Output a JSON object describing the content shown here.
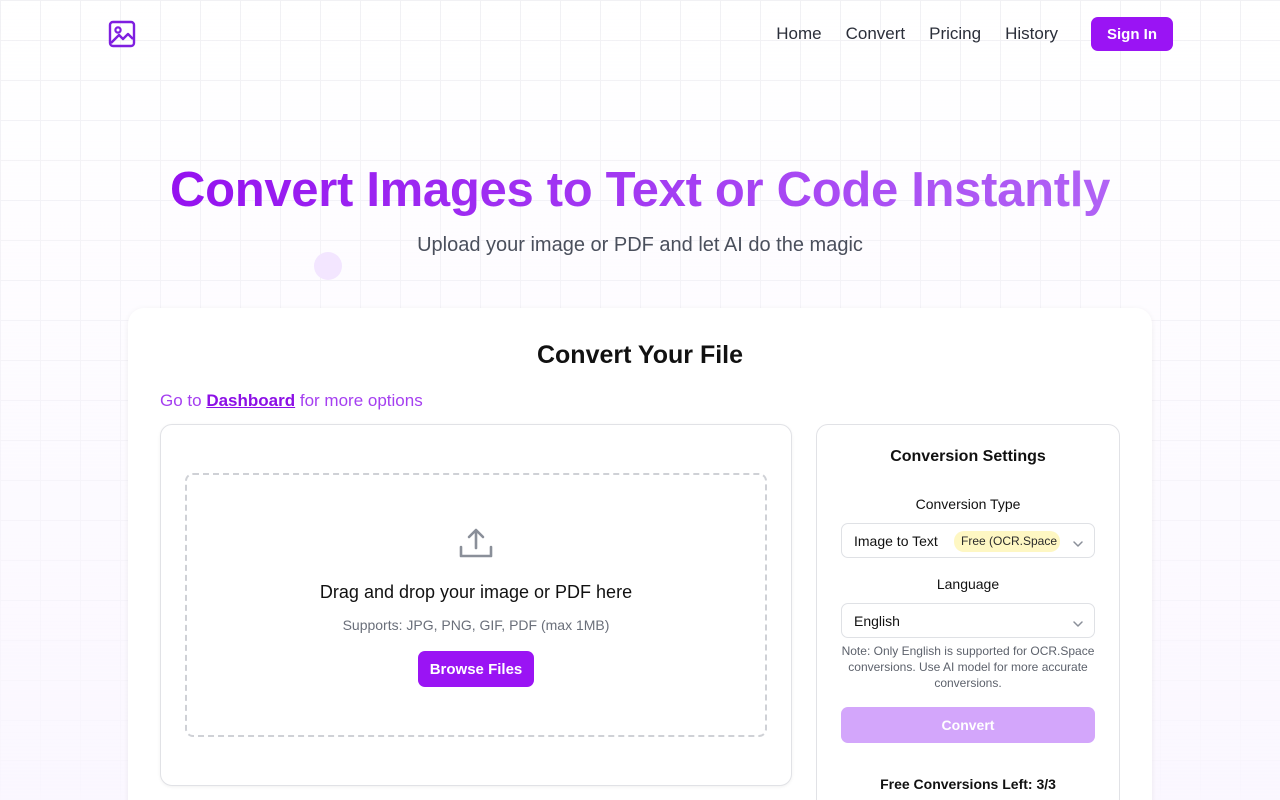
{
  "header": {
    "logo_icon": "image-icon",
    "nav": [
      {
        "label": "Home"
      },
      {
        "label": "Convert"
      },
      {
        "label": "Pricing"
      },
      {
        "label": "History"
      }
    ],
    "signin_label": "Sign In"
  },
  "hero": {
    "title": "Convert Images to Text or Code Instantly",
    "subtitle": "Upload your image or PDF and let AI do the magic"
  },
  "card": {
    "title": "Convert Your File",
    "dashboard_prefix": "Go to",
    "dashboard_link": "Dashboard",
    "dashboard_suffix": "for more options"
  },
  "upload": {
    "icon": "upload-icon",
    "title": "Drag and drop your image or PDF here",
    "supports": "Supports: JPG, PNG, GIF, PDF (max 1MB)",
    "browse_label": "Browse Files"
  },
  "settings": {
    "title": "Conversion Settings",
    "type_label": "Conversion Type",
    "type_value": "Image to Text",
    "type_badge": "Free (OCR.Space",
    "language_label": "Language",
    "language_value": "English",
    "note": "Note: Only English is supported for OCR.Space conversions. Use AI model for more accurate conversions.",
    "convert_label": "Convert",
    "free_left": "Free Conversions Left: 3/3"
  },
  "colors": {
    "accent": "#9a14f4",
    "accent_disabled": "#d3a6fb",
    "badge": "#fef7c3"
  }
}
